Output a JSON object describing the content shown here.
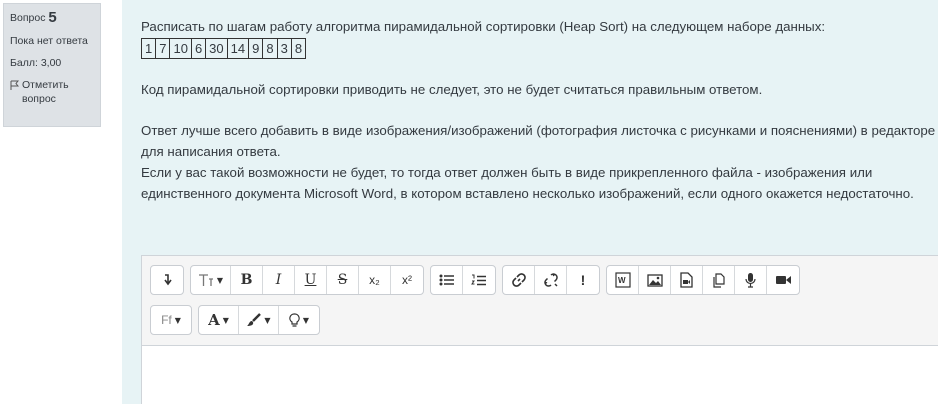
{
  "info": {
    "question_label": "Вопрос",
    "question_number": "5",
    "status": "Пока нет ответа",
    "score": "Балл: 3,00",
    "flag_label": "Отметить вопрос"
  },
  "question": {
    "intro": "Расписать по шагам работу алгоритма пирамидальной сортировки (Heap Sort) на следующем наборе данных:",
    "data": [
      "1",
      "7",
      "10",
      "6",
      "30",
      "14",
      "9",
      "8",
      "3",
      "8"
    ],
    "note": "Код пирамидальной сортировки приводить не следует, это не будет считаться правильным ответом.",
    "answer_hint_1": "Ответ лучше всего добавить в виде изображения/изображений (фотография листочка с рисунками и пояснениями) в редакторе для написания ответа.",
    "answer_hint_2": "Если у вас такой возможности не будет, то тогда ответ должен быть в виде прикрепленного файла - изображения или единственного документа Microsoft Word, в котором вставлено несколько изображений, если одного окажется недостаточно."
  },
  "editor": {
    "toolbar": {
      "bold": "B",
      "italic": "I",
      "underline": "U",
      "strike": "S",
      "subscript": "x₂",
      "superscript": "x²",
      "font_family": "Ff",
      "font_color": "A",
      "important": "!"
    }
  }
}
